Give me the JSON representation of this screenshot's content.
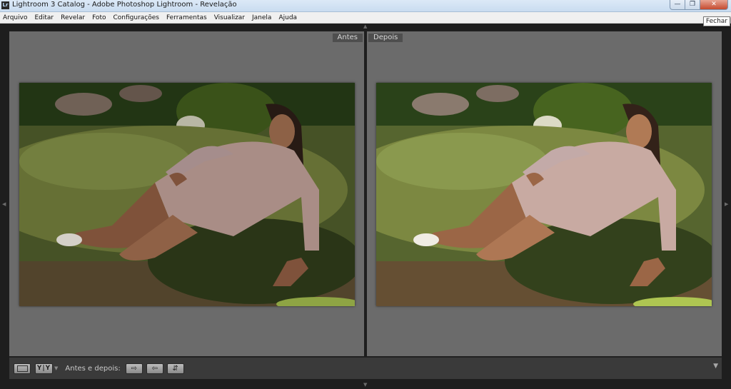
{
  "window": {
    "title": "Lightroom 3 Catalog - Adobe Photoshop Lightroom - Revelação",
    "app_icon_text": "Lr",
    "close_tooltip": "Fechar"
  },
  "menu": [
    "Arquivo",
    "Editar",
    "Revelar",
    "Foto",
    "Configurações",
    "Ferramentas",
    "Visualizar",
    "Janela",
    "Ajuda"
  ],
  "panes": {
    "before_label": "Antes",
    "after_label": "Depois"
  },
  "toolbar": {
    "before_after_label": "Antes e depois:",
    "yy_label": "Y|Y"
  },
  "icons": {
    "minimize": "minimize-icon",
    "maximize": "restore-icon",
    "close": "close-icon",
    "loupe": "loupe-view-icon",
    "before_after_view": "before-after-view-icon",
    "copy_before_to_after": "copy-settings-icon",
    "copy_after_to_before": "copy-settings-reverse-icon",
    "swap": "swap-settings-icon"
  },
  "colors": {
    "pane_bg": "#6b6b6b",
    "workspace_bg": "#1e1e1e",
    "toolbar_bg": "#3a3a3a"
  }
}
